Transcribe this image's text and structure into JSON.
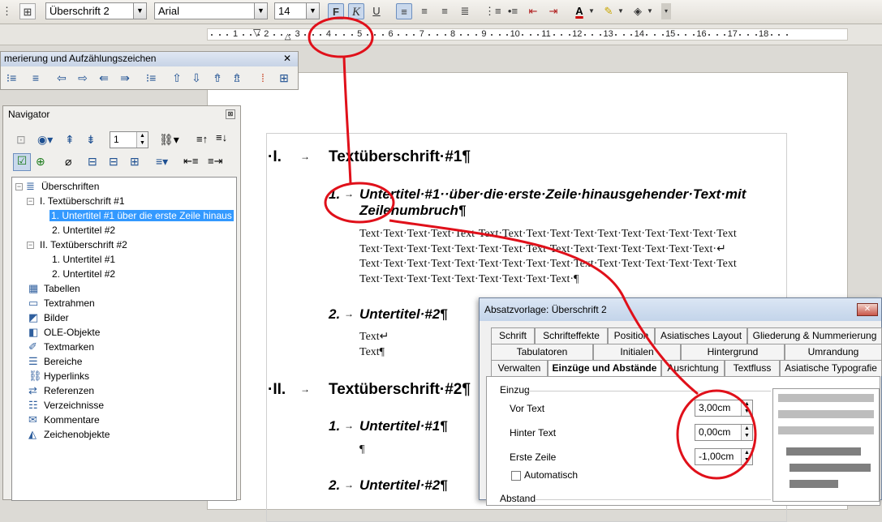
{
  "toolbar": {
    "style": "Überschrift 2",
    "font": "Arial",
    "size": "14",
    "bold": "F",
    "italic": "K",
    "underline": "U",
    "font_color_letter": "A"
  },
  "ruler": {
    "numbers": [
      "1",
      "2",
      "3",
      "4",
      "5",
      "6",
      "7",
      "8",
      "9",
      "10",
      "11",
      "12",
      "13",
      "14",
      "15",
      "16",
      "17",
      "18"
    ]
  },
  "numbering_toolbar": {
    "title": "merierung und Aufzählungszeichen",
    "close": "✕"
  },
  "navigator": {
    "title": "Navigator",
    "page": "1",
    "tree": [
      {
        "label": "Überschriften",
        "level": 0
      },
      {
        "label": "I. Textüberschrift #1",
        "level": 1
      },
      {
        "label": "1. Untertitel #1  über die erste Zeile hinaus",
        "level": 2,
        "selected": true
      },
      {
        "label": "2. Untertitel #2",
        "level": 2
      },
      {
        "label": "II. Textüberschrift #2",
        "level": 1
      },
      {
        "label": "1. Untertitel #1",
        "level": 2
      },
      {
        "label": "2. Untertitel #2",
        "level": 2
      },
      {
        "label": "Tabellen",
        "level": 0
      },
      {
        "label": "Textrahmen",
        "level": 0
      },
      {
        "label": "Bilder",
        "level": 0
      },
      {
        "label": "OLE-Objekte",
        "level": 0
      },
      {
        "label": "Textmarken",
        "level": 0
      },
      {
        "label": "Bereiche",
        "level": 0
      },
      {
        "label": "Hyperlinks",
        "level": 0
      },
      {
        "label": "Referenzen",
        "level": 0
      },
      {
        "label": "Verzeichnisse",
        "level": 0
      },
      {
        "label": "Kommentare",
        "level": 0
      },
      {
        "label": "Zeichenobjekte",
        "level": 0
      }
    ]
  },
  "document": {
    "h1a_num": "·I.",
    "h1a_text": "Textüberschrift·#1¶",
    "h2a_num": "1.",
    "h2a_line1": "Untertitel·#1··über·die·erste·Zeile·hinausgehender·Text·mit",
    "h2a_line2": "Zeilenumbruch¶",
    "body1": [
      "Text·Text·Text·Text·Text·Text·Text·Text·Text·Text·Text·Text·Text·Text·Text·Text",
      "Text·Text·Text·Text·Text·Text·Text·Text·Text·Text·Text·Text·Text·Text·Text·↵",
      "Text·Text·Text·Text·Text·Text·Text·Text·Text·Text·Text·Text·Text·Text·Text·Text",
      "Text·Text·Text·Text·Text·Text·Text·Text·Text·¶"
    ],
    "h2b_num": "2.",
    "h2b_text": "Untertitel·#2¶",
    "body2": [
      "Text↵",
      "Text¶"
    ],
    "h1b_num": "·II.",
    "h1b_text": "Textüberschrift·#2¶",
    "h2c_num": "1.",
    "h2c_text": "Untertitel·#1¶",
    "pilcrow": "¶",
    "h2d_num": "2.",
    "h2d_text": "Untertitel·#2¶"
  },
  "dialog": {
    "title": "Absatzvorlage: Überschrift 2",
    "tabs_row1": [
      "Schrift",
      "Schrifteffekte",
      "Position",
      "Asiatisches Layout",
      "Gliederung & Nummerierung"
    ],
    "tabs_row2": [
      "Tabulatoren",
      "Initialen",
      "Hintergrund",
      "Umrandung"
    ],
    "tabs_row3": [
      "Verwalten",
      "Einzüge und Abstände",
      "Ausrichtung",
      "Textfluss",
      "Asiatische Typografie"
    ],
    "group": "Einzug",
    "vor_label": "Vor Text",
    "vor_value": "3,00cm",
    "hinter_label": "Hinter Text",
    "hinter_value": "0,00cm",
    "erste_label": "Erste Zeile",
    "erste_value": "-1,00cm",
    "auto_label": "Automatisch",
    "abstand_label": "Abstand"
  }
}
